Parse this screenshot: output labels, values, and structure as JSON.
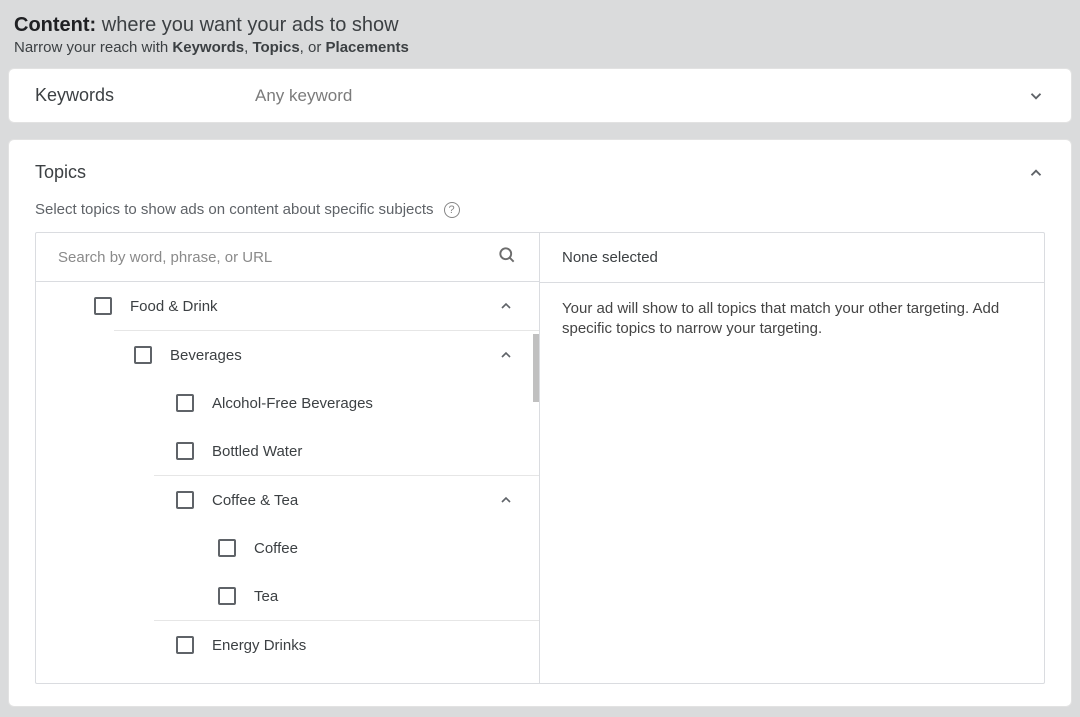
{
  "header": {
    "title_bold": "Content:",
    "title_rest": " where you want your ads to show",
    "sub_pre": "Narrow your reach with ",
    "sub_k": "Keywords",
    "sub_sep1": ", ",
    "sub_t": "Topics",
    "sub_sep2": ", or ",
    "sub_p": "Placements"
  },
  "keywords_row": {
    "label": "Keywords",
    "value": "Any keyword"
  },
  "topics": {
    "label": "Topics",
    "description": "Select topics to show ads on content about specific subjects",
    "search_placeholder": "Search by word, phrase, or URL",
    "right_header": "None selected",
    "right_body": "Your ad will show to all topics that match your other targeting. Add specific topics to narrow your targeting.",
    "tree": {
      "food_drink": "Food & Drink",
      "beverages": "Beverages",
      "alcohol_free": "Alcohol-Free Beverages",
      "bottled_water": "Bottled Water",
      "coffee_tea": "Coffee & Tea",
      "coffee": "Coffee",
      "tea": "Tea",
      "energy_drinks": "Energy Drinks"
    }
  }
}
